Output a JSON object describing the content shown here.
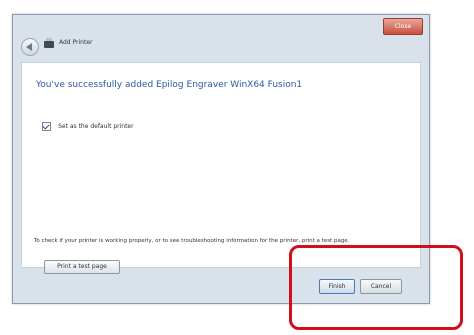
{
  "window": {
    "close_label": "Close",
    "title": "Add Printer"
  },
  "wizard": {
    "heading": "You've successfully added Epilog Engraver WinX64 Fusion1",
    "default_printer_checkbox": {
      "label": "Set as the default printer",
      "checked": true
    },
    "info_text": "To check if your printer is working properly, or to see troubleshooting information for the printer, print a test page.",
    "print_test_page_button": "Print a test page"
  },
  "footer": {
    "finish_label": "Finish",
    "cancel_label": "Cancel"
  },
  "annotation": {
    "highlight_color": "#d10f1a"
  }
}
